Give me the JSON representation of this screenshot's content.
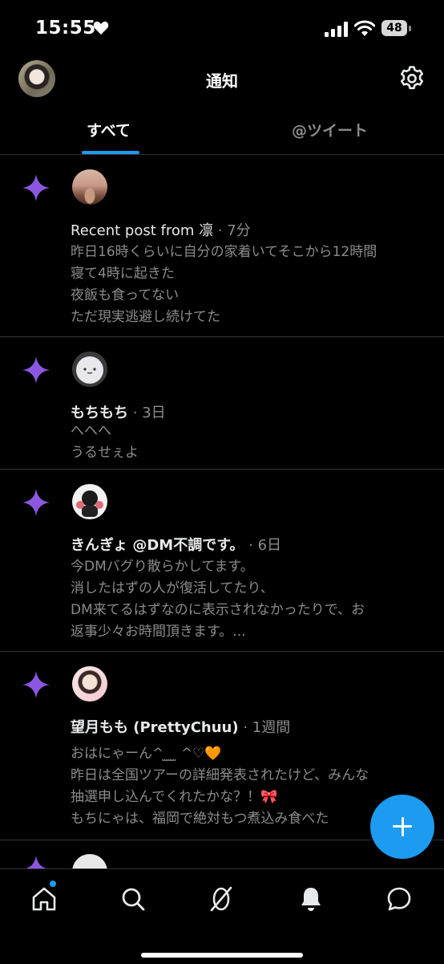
{
  "status_bar": {
    "time": "15:55",
    "battery": "48"
  },
  "header": {
    "title": "通知"
  },
  "tabs": [
    {
      "label": "すべて",
      "active": true
    },
    {
      "label": "@ツイート",
      "active": false
    }
  ],
  "notifications": [
    {
      "name": "Recent post from 凛",
      "name_bold": false,
      "meta": " · 7分",
      "body": "昨日16時くらいに自分の家着いてそこから12時間\n寝て4時に起きた\n夜飯も食ってない\nただ現実逃避し続けてた"
    },
    {
      "name": "もちもち",
      "name_bold": true,
      "meta": " · 3日",
      "body": "へへへ\nうるせぇよ"
    },
    {
      "name": "きんぎょ @DM不調です。",
      "name_bold": true,
      "meta": " · 6日",
      "body": "今DMバグり散らかしてます。\n消したはずの人が復活してたり、\nDM来てるはずなのに表示されなかったりで、お\n返事少々お時間頂きます。..."
    },
    {
      "name": "望月もも (PrettyChuu)",
      "name_bold": true,
      "meta": " · 1週間",
      "body": "おはにゃーん^ ̫ ̫ ̫ ^♡🧡\n昨日は全国ツアーの詳細発表されたけど、みんな\n抽選申し込んでくれたかな？！🎀\nもちにゃは、福岡で絶対もつ煮込み食べた"
    }
  ],
  "colors": {
    "background": "#000000",
    "accent": "#1d9bf0",
    "sparkle": "#8b57e0",
    "muted_text": "#8b8b8b"
  },
  "icons": [
    "heart-icon",
    "signal-icon",
    "wifi-icon",
    "battery-icon",
    "settings-icon",
    "sparkle-icon",
    "compose-plus-icon",
    "home-icon",
    "search-icon",
    "spaces-icon",
    "notifications-bell-icon",
    "messages-icon"
  ]
}
